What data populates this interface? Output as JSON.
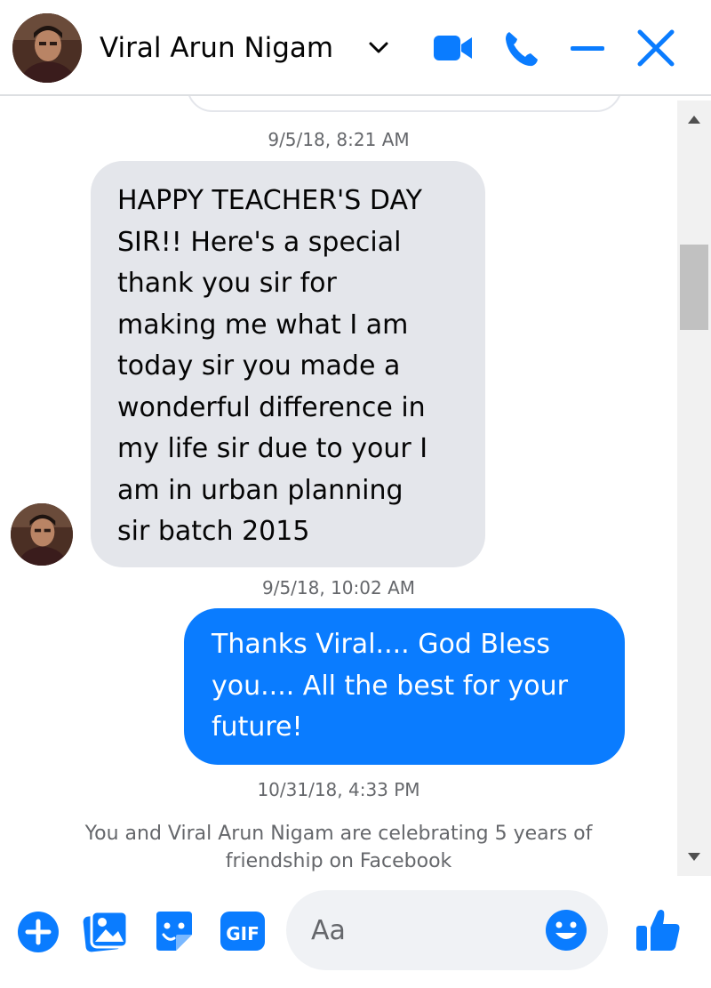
{
  "header": {
    "contact_name": "Viral Arun Nigam",
    "icons": [
      "chevron-down-icon",
      "video-call-icon",
      "phone-icon",
      "minimize-icon",
      "close-icon"
    ]
  },
  "colors": {
    "accent": "#0a7cff",
    "incoming_bubble": "#e4e6eb",
    "timestamp_text": "#65676b"
  },
  "messages": [
    {
      "timestamp": "9/5/18, 8:21 AM",
      "direction": "incoming",
      "lines": [
        "HAPPY TEACHER'S DAY",
        "SIR!! Here's a special",
        "thank you sir for",
        "making me what I am",
        "today sir you made a",
        "wonderful difference in",
        "my life sir due to your I",
        "am in urban planning",
        "sir batch 2015"
      ]
    },
    {
      "timestamp": "9/5/18, 10:02 AM",
      "direction": "outgoing",
      "lines": [
        "Thanks Viral.... God Bless",
        "you.... All the best for your",
        "future!"
      ]
    }
  ],
  "event": {
    "timestamp": "10/31/18, 4:33 PM",
    "lines": [
      "You and Viral Arun Nigam are celebrating 5 years of",
      "friendship on Facebook"
    ]
  },
  "composer": {
    "placeholder": "Aa",
    "icons": [
      "add-icon",
      "photo-icon",
      "sticker-icon",
      "gif-icon",
      "emoji-icon",
      "like-icon"
    ],
    "gif_label": "GIF"
  }
}
